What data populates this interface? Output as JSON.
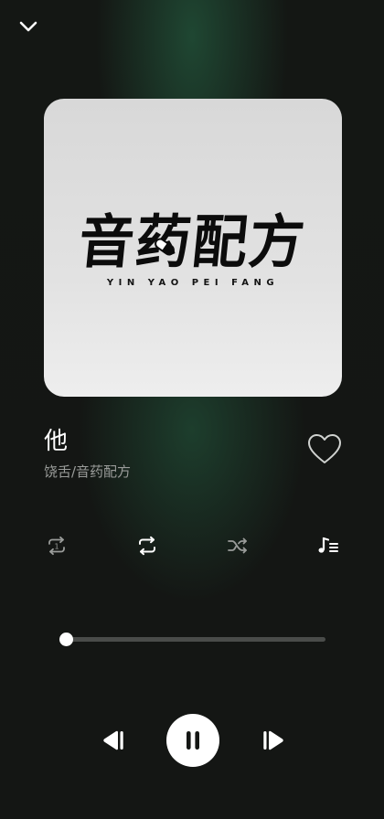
{
  "player": {
    "collapse_icon": "chevron-down-icon",
    "album": {
      "art_title": "音药配方",
      "art_subtitle": "YIN YAO PEI FANG",
      "art_background": "#dcdcdc"
    },
    "track": {
      "title": "他",
      "artist": "饶舌/音药配方",
      "liked": false
    },
    "modes": [
      {
        "name": "repeat-one",
        "icon": "repeat-one-icon",
        "active": false
      },
      {
        "name": "repeat-all",
        "icon": "repeat-icon",
        "active": true
      },
      {
        "name": "shuffle",
        "icon": "shuffle-icon",
        "active": false
      },
      {
        "name": "lyrics",
        "icon": "lyrics-icon",
        "active": true
      }
    ],
    "progress": {
      "fraction": 0.0
    },
    "controls": {
      "previous_icon": "skip-previous-icon",
      "play_state": "playing",
      "play_icon": "pause-icon",
      "next_icon": "skip-next-icon"
    },
    "colors": {
      "accent": "#ffffff",
      "background": "#141614",
      "glow": "#2a6e4b",
      "muted_text": "#9a9c9a",
      "inactive_icon": "#9a9c9a"
    }
  }
}
